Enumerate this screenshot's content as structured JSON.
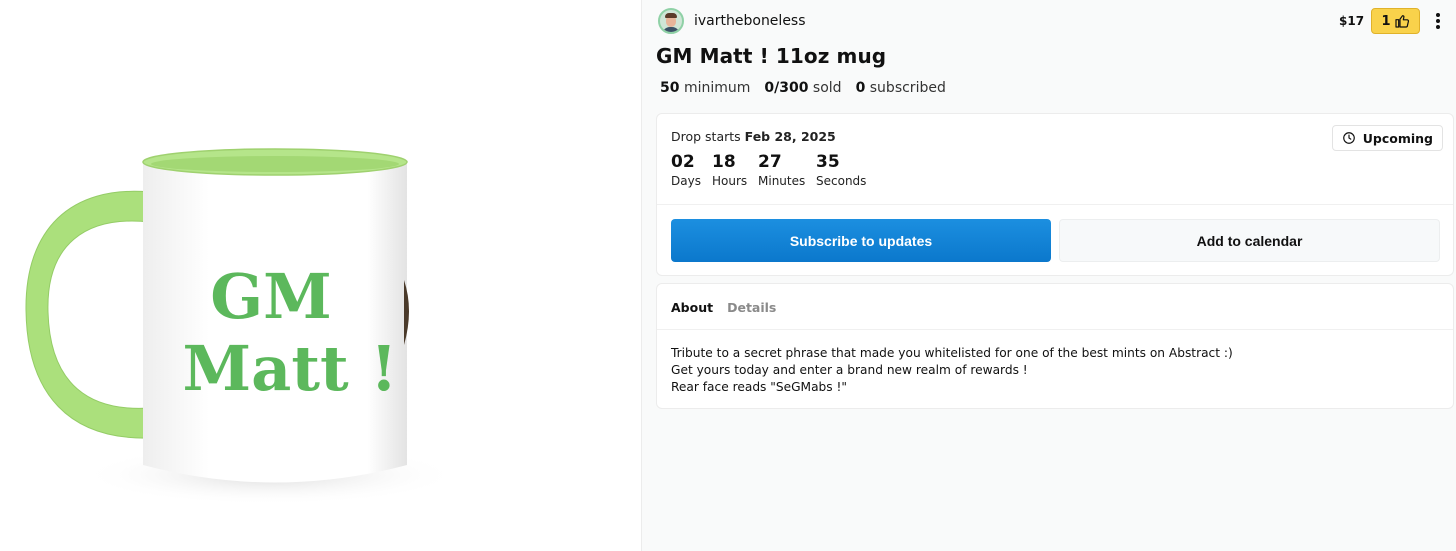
{
  "product_image": {
    "mug_text_line1": "GM",
    "mug_text_line2": "Matt !",
    "mug_color": "#ffffff",
    "accent_color": "#a9e07a",
    "text_color": "#5cb85c"
  },
  "header": {
    "creator_name": "ivartheboneless",
    "price": "$17",
    "like_count": "1",
    "like_icon": "thumbs-up-icon",
    "menu_icon": "more-vertical-icon"
  },
  "product": {
    "title": "GM Matt ! 11oz mug",
    "stats": [
      {
        "value": "50",
        "label": "minimum"
      },
      {
        "value": "0/300",
        "label": "sold"
      },
      {
        "value": "0",
        "label": "subscribed"
      }
    ]
  },
  "drop": {
    "prefix": "Drop starts",
    "date": "Feb 28, 2025",
    "status": "Upcoming",
    "status_icon": "clock-icon",
    "countdown": [
      {
        "num": "02",
        "unit": "Days"
      },
      {
        "num": "18",
        "unit": "Hours"
      },
      {
        "num": "27",
        "unit": "Minutes"
      },
      {
        "num": "35",
        "unit": "Seconds"
      }
    ],
    "subscribe_label": "Subscribe to updates",
    "calendar_label": "Add to calendar",
    "primary_color": "#1584d6"
  },
  "about": {
    "tabs": [
      "About",
      "Details"
    ],
    "lines": [
      "Tribute to a secret phrase that made you whitelisted for one of the best mints on Abstract :)",
      "Get yours today and enter a brand new realm of rewards !",
      "Rear face reads \"SeGMabs !\""
    ]
  }
}
